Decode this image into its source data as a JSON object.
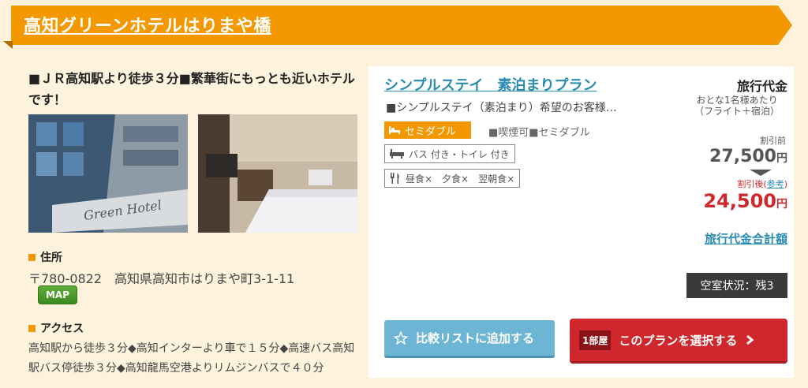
{
  "hotel": {
    "name": "高知グリーンホテルはりまや橋",
    "catchphrase": "■ＪＲ高知駅より徒歩３分■繁華街にもっとも近いホテルです！",
    "photos": [
      "building-photo",
      "room-photo"
    ],
    "photo_sign_text": "Green Hotel"
  },
  "address": {
    "label": "住所",
    "value": "〒780-0822　高知県高知市はりまや町3-1-11",
    "map_button": "MAP"
  },
  "access": {
    "label": "アクセス",
    "value": "高知駅から徒歩３分◆高知インターより車で１５分◆高速バス高知駅バス停徒歩３分◆高知龍馬空港よりリムジンバスで４０分"
  },
  "plan": {
    "title": "シンプルステイ　素泊まりプラン",
    "description": "■シンプルステイ（素泊まり）希望のお客様…",
    "room_type": "セミダブル",
    "room_spec": "■喫煙可■セミダブル",
    "bath": "バス 付き・トイレ 付き",
    "meals": "昼食×　夕食×　翌朝食×"
  },
  "price": {
    "heading": "旅行代金",
    "per_person": "おとな1名様あたり",
    "package": "（フライト＋宿泊）",
    "before_label": "割引前",
    "before_amount": "27,500",
    "after_label": "割引後(",
    "after_link": "参考",
    "after_label_end": ")",
    "after_amount": "24,500",
    "currency": "円",
    "total_link": "旅行代金合計額"
  },
  "vacancy": "空室状況：残3",
  "buttons": {
    "compare": "比較リストに追加する",
    "room_count": "1部屋",
    "select": "このプランを選択する"
  },
  "colors": {
    "banner": "#f39800",
    "background": "#fdf3dc",
    "link": "#2a8bb0",
    "discount": "#d0272c"
  }
}
